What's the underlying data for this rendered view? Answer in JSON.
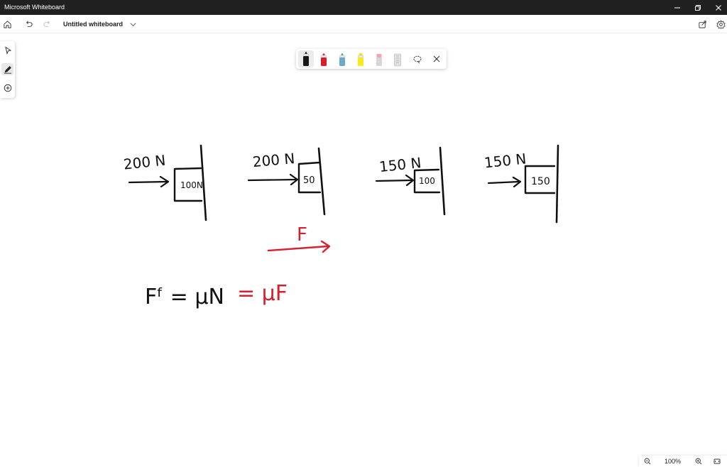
{
  "window": {
    "app_title": "Microsoft Whiteboard"
  },
  "toolbar": {
    "board_title": "Untitled whiteboard"
  },
  "zoom": {
    "level": "100%"
  },
  "board": {
    "diagrams": [
      {
        "force_label": "200 N",
        "block_label": "100N"
      },
      {
        "force_label": "200 N",
        "block_label": "50"
      },
      {
        "force_label": "150 N",
        "block_label": "100"
      },
      {
        "force_label": "150 N",
        "block_label": "150"
      }
    ],
    "red_force_label": "F",
    "equation_black": "Fᶠ = μN",
    "equation_red": "= μF"
  },
  "colors": {
    "ink_black": "#111111",
    "ink_red": "#d81f2c",
    "titlebar": "#202020"
  }
}
